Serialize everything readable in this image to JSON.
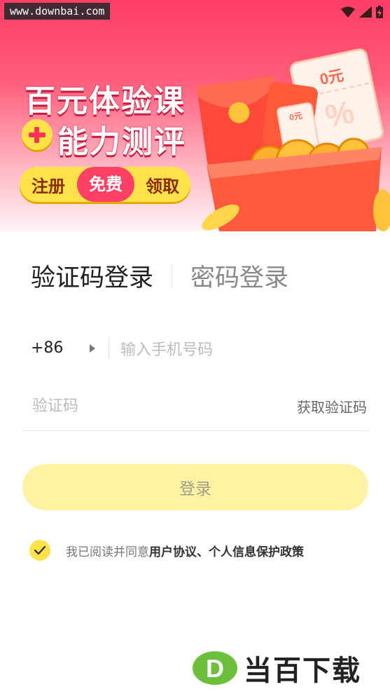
{
  "status_bar": {
    "watermark_url": "www.downbai.com",
    "icons": [
      "wifi-icon",
      "signal-icon",
      "battery-charging-icon"
    ]
  },
  "banner": {
    "line1": "百元体验课",
    "line2": "能力测评",
    "pill": {
      "part1": "注册",
      "part2": "免费",
      "part3": "领取"
    },
    "ticket_label": "0元",
    "small_ticket_label": "0元",
    "colors": {
      "top": "#ff3d67",
      "accent_yellow": "#ffe24a",
      "accent_red": "#ff3f64"
    }
  },
  "login_tabs": {
    "active": "验证码登录",
    "inactive": "密码登录"
  },
  "phone": {
    "country_code": "+86",
    "placeholder": "输入手机号码"
  },
  "code": {
    "placeholder": "验证码",
    "get_code_label": "获取验证码"
  },
  "login_button": "登录",
  "agreement": {
    "checked": true,
    "prefix": "我已阅读并同意",
    "link_text": "用户协议、个人信息保护政策"
  },
  "footer_logo": {
    "mark": "D",
    "name": "当百下载"
  }
}
